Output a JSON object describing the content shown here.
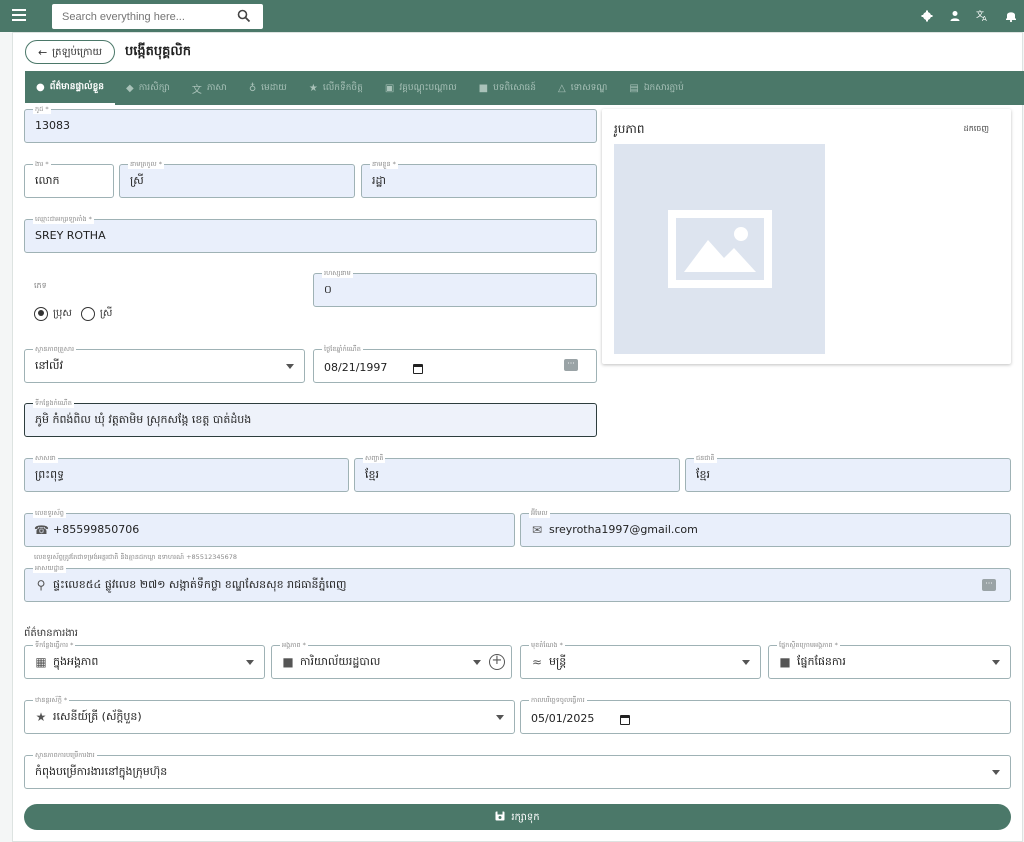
{
  "search": {
    "placeholder": "Search everything here..."
  },
  "header": {
    "back_label": "ត្រឡប់ក្រោយ",
    "title": "បង្កើតបុគ្គលិក"
  },
  "tabs": [
    {
      "label": "ព័ត៌មានផ្ទាល់ខ្លួន",
      "icon": "info-icon",
      "active": true
    },
    {
      "label": "ការសិក្សា",
      "icon": "graduation-cap-icon"
    },
    {
      "label": "ភាសា",
      "icon": "translate-icon"
    },
    {
      "label": "មេដាយ",
      "icon": "medal-icon"
    },
    {
      "label": "លើកទឹកចិត្ត",
      "icon": "star-icon"
    },
    {
      "label": "វគ្គបណ្តុះបណ្តាល",
      "icon": "presentation-icon"
    },
    {
      "label": "បទពិសោធន៍",
      "icon": "briefcase-icon"
    },
    {
      "label": "ទោសទណ្ឌ",
      "icon": "warning-icon"
    },
    {
      "label": "ឯកសារភ្ជាប់",
      "icon": "document-icon"
    }
  ],
  "form": {
    "code": {
      "label": "កូដ *",
      "value": "13083"
    },
    "title": {
      "label": "ងារ *",
      "value": "លោក"
    },
    "family_name": {
      "label": "នាមត្រកូល *",
      "value": "ស្រី"
    },
    "given_name": {
      "label": "នាមខ្លួន *",
      "value": "រដ្ឋា"
    },
    "latin_name": {
      "label": "ឈ្មោះជាអក្សរឡាតាំង *",
      "value": "SREY ROTHA"
    },
    "gender": {
      "label": "ភេទ",
      "options": [
        "ប្រុស",
        "ស្រី"
      ],
      "selected": "ប្រុស"
    },
    "nickname": {
      "label": "រហស្សនាម",
      "value": "០"
    },
    "marital_status": {
      "label": "ស្ថានភាពគ្រួសារ",
      "value": "នៅលីវ"
    },
    "dob": {
      "label": "ថ្ងៃខែឆ្នាំកំណើត",
      "value": "08/21/1997"
    },
    "pob": {
      "label": "ទីកន្លែងកំណើត",
      "value": "ភូមិ កំពង់ពិល ឃុំ វត្តតាមិម ស្រុកសង្កែ ខេត្ត បាត់ដំបង"
    },
    "religion": {
      "label": "សាសនា",
      "value": "ព្រះពុទ្ធ"
    },
    "race": {
      "label": "សញ្ជាតិ",
      "value": "ខ្មែរ"
    },
    "nationality": {
      "label": "ជនជាតិ",
      "value": "ខ្មែរ"
    },
    "phone": {
      "label": "លេខទូរស័ព្ទ",
      "value": "+85599850706",
      "hint": "លេខទូរស័ព្ទត្រូវតែជាទម្រង់អន្តរជាតិ និងគ្មានដកឃ្លា ឧទាហរណ៍ +85512345678"
    },
    "email": {
      "label": "អ៊ីមែល",
      "value": "sreyrotha1997@gmail.com"
    },
    "address": {
      "label": "អាសយដ្ឋាន",
      "value": "ផ្ទះលេខ៥៤ ផ្លូវលេខ ២៧១ សង្កាត់ទឹកថ្លា ខណ្ឌសែនសុខ រាជធានីភ្នំពេញ"
    }
  },
  "photo": {
    "title": "រូបភាព",
    "remove_label": "ដកចេញ"
  },
  "work": {
    "section_label": "ព័ត៌មានការងារ",
    "location": {
      "label": "ទីកន្លែងធ្វើការ *",
      "value": "ក្នុងអង្គភាព"
    },
    "unit": {
      "label": "អង្គភាព *",
      "value": "ការិយាល័យរដ្ឋបាល"
    },
    "position": {
      "label": "មុខតំណែង *",
      "value": "មន្ត្រី"
    },
    "department": {
      "label": "ផ្នែកស្ថិតក្រោមអង្គភាព *",
      "value": "ផ្នែកផែនការ"
    },
    "rank": {
      "label": "ឋានន្តរស័ក្តិ *",
      "value": "រសេនីយ៍ត្រី (ស័ក្តិបួន)"
    },
    "start_date": {
      "label": "កាលបរិច្ឆេទចូលធ្វើការ",
      "value": "05/01/2025"
    },
    "work_status": {
      "label": "ស្ថានភាពការបម្រើការងារ",
      "value": "កំពុងបម្រើការងារនៅក្នុងក្រុមហ៊ុន"
    }
  },
  "save_label": "រក្សាទុក"
}
